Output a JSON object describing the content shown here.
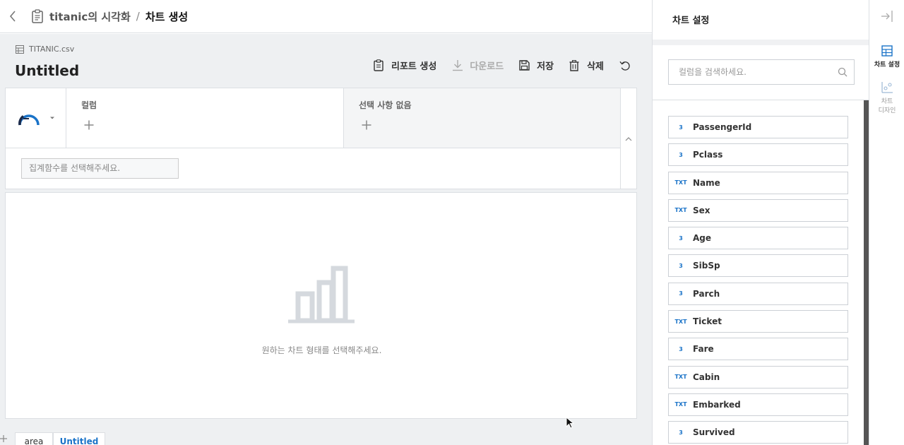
{
  "header": {
    "breadcrumb_parent": "titanic의 시각화",
    "separator": "/",
    "breadcrumb_current": "차트 생성"
  },
  "file": {
    "name": "TITANIC.csv"
  },
  "title": "Untitled",
  "toolbar": {
    "report_label": "리포트 생성",
    "download_label": "다운로드",
    "save_label": "저장",
    "delete_label": "삭제"
  },
  "config": {
    "column_label": "컬럼",
    "selection_label": "선택 사항 없음",
    "aggregate_placeholder": "집계함수를 선택해주세요."
  },
  "chart_area": {
    "empty_message": "원하는 차트 형태를 선택해주세요."
  },
  "tabs": [
    {
      "label": "area"
    },
    {
      "label": "Untitled"
    }
  ],
  "panel": {
    "title": "차트 설정",
    "search_placeholder": "컬럼을 검색하세요.",
    "columns": [
      {
        "type": "3",
        "name": "PassengerId"
      },
      {
        "type": "3",
        "name": "Pclass"
      },
      {
        "type": "TXT",
        "name": "Name"
      },
      {
        "type": "TXT",
        "name": "Sex"
      },
      {
        "type": "3",
        "name": "Age"
      },
      {
        "type": "3",
        "name": "SibSp"
      },
      {
        "type": "3",
        "name": "Parch"
      },
      {
        "type": "TXT",
        "name": "Ticket"
      },
      {
        "type": "3",
        "name": "Fare"
      },
      {
        "type": "TXT",
        "name": "Cabin"
      },
      {
        "type": "TXT",
        "name": "Embarked"
      },
      {
        "type": "3",
        "name": "Survived"
      }
    ]
  },
  "rail": {
    "chart_settings": "차트 설정",
    "chart_design_1": "차트",
    "chart_design_2": "디자인"
  },
  "colors": {
    "accent": "#1a73c8",
    "background": "#eef0f2",
    "border": "#dcdfe3"
  }
}
